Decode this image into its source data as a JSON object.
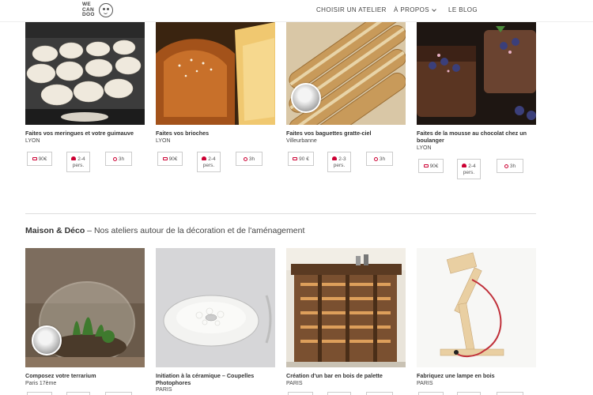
{
  "header": {
    "logo_text": "WE\nCAN\nDOO",
    "nav": [
      {
        "label": "CHOISIR UN ATELIER"
      },
      {
        "label": "À PROPOS"
      },
      {
        "label": "LE BLOG"
      }
    ]
  },
  "cards_row1": [
    {
      "title": "Faites vos meringues et votre guimauve",
      "location": "LYON",
      "price": "90€",
      "pers_line1": "2-4",
      "pers_line2": "pers.",
      "time": "3h"
    },
    {
      "title": "Faites vos brioches",
      "location": "LYON",
      "price": "90€",
      "pers_line1": "2-4",
      "pers_line2": "pers.",
      "time": "3h"
    },
    {
      "title": "Faites vos baguettes gratte-ciel",
      "location": "Villeurbanne",
      "price": "90 €",
      "pers_line1": "2-3",
      "pers_line2": "pers.",
      "time": "3h"
    },
    {
      "title": "Faites de la mousse au chocolat chez un boulanger",
      "location": "LYON",
      "price": "90€",
      "pers_line1": "2-4",
      "pers_line2": "pers.",
      "time": "3h"
    }
  ],
  "section": {
    "name": "Maison & Déco",
    "subtitle": " – Nos ateliers autour de la décoration et de l'aménagement"
  },
  "cards_row2": [
    {
      "title": "Composez votre terrarium",
      "location": "Paris 17ème"
    },
    {
      "title": "Initiation à la céramique – Coupelles Photophores",
      "location": "PARIS"
    },
    {
      "title": "Création d'un bar en bois de palette",
      "location": "PARIS"
    },
    {
      "title": "Fabriquez une lampe en bois",
      "location": "PARIS"
    }
  ],
  "icons": {
    "price": "price-icon",
    "pers": "people-icon",
    "time": "clock-icon"
  },
  "colors": {
    "accent": "#cc0033",
    "text": "#333333",
    "border": "#cccccc"
  }
}
